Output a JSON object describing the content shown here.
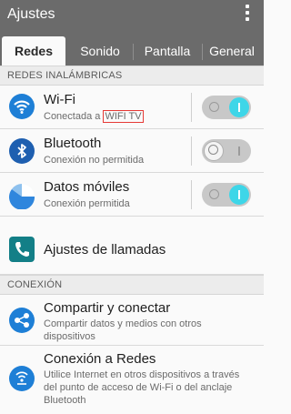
{
  "appbar": {
    "title": "Ajustes",
    "menu_icon": "overflow-menu-icon"
  },
  "tabs": [
    {
      "label": "Redes",
      "active": true
    },
    {
      "label": "Sonido",
      "active": false
    },
    {
      "label": "Pantalla",
      "active": false
    },
    {
      "label": "General",
      "active": false
    }
  ],
  "sections": {
    "wireless": "REDES INALÁMBRICAS",
    "connection": "CONEXIÓN"
  },
  "items": {
    "wifi": {
      "title": "Wi-Fi",
      "subtitle_prefix": "Conectada a ",
      "network": "WIFI TV",
      "toggle": "on",
      "icon": "wifi-icon"
    },
    "bluetooth": {
      "title": "Bluetooth",
      "subtitle": "Conexión no permitida",
      "toggle": "off",
      "icon": "bluetooth-icon"
    },
    "mobile_data": {
      "title": "Datos móviles",
      "subtitle": "Conexión permitida",
      "toggle": "on",
      "icon": "mobile-data-icon"
    },
    "call_settings": {
      "title": "Ajustes de llamadas",
      "icon": "phone-icon"
    },
    "share_connect": {
      "title": "Compartir y conectar",
      "subtitle": "Compartir datos y medios con otros dispositivos",
      "icon": "share-icon"
    },
    "tethering": {
      "title": "Conexión a Redes",
      "subtitle": "Utilice Internet en otros dispositivos a través del punto de acceso de Wi-Fi o del anclaje Bluetooth",
      "icon": "tethering-icon"
    }
  },
  "colors": {
    "appbar": "#6b6b6b",
    "toggle_on": "#3ed6e8",
    "highlight": "#e53935",
    "icon_blue": "#1e7fd6"
  }
}
